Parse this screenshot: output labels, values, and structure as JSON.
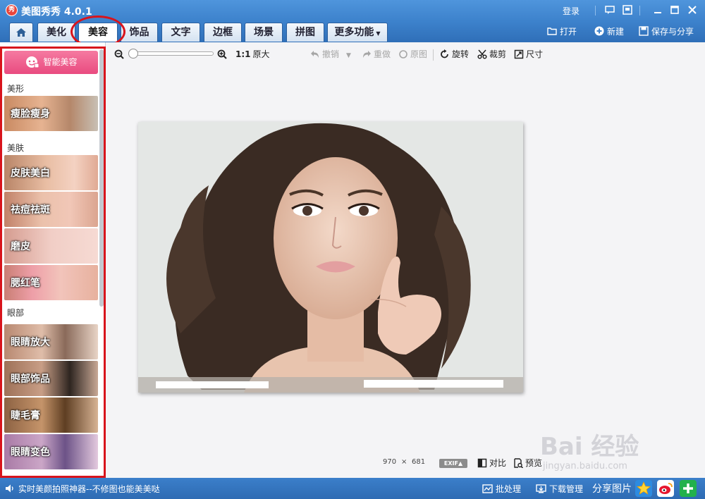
{
  "window": {
    "logo_glyph": "秀",
    "title": "美图秀秀 4.0.1",
    "login": "登录",
    "controls": [
      "message-icon",
      "skin-icon",
      "minimize-icon",
      "maximize-icon",
      "close-icon"
    ]
  },
  "tabs": [
    {
      "label": "美化",
      "active": false
    },
    {
      "label": "美容",
      "active": true
    },
    {
      "label": "饰品",
      "active": false
    },
    {
      "label": "文字",
      "active": false
    },
    {
      "label": "边框",
      "active": false
    },
    {
      "label": "场景",
      "active": false
    },
    {
      "label": "拼图",
      "active": false
    },
    {
      "label": "更多功能",
      "active": false
    }
  ],
  "actions": {
    "open": "打开",
    "new": "新建",
    "save_share": "保存与分享"
  },
  "toolbar": {
    "original_size_ratio": "1:1",
    "original_size": "原大",
    "undo": "撤销",
    "redo": "重做",
    "original": "原图",
    "rotate": "旋转",
    "crop": "裁剪",
    "size": "尺寸",
    "zoom_level": 0.0
  },
  "panel": {
    "smart_beauty": "智能美容",
    "categories": [
      {
        "label": "美形",
        "items": [
          "瘦脸瘦身"
        ]
      },
      {
        "label": "美肤",
        "items": [
          "皮肤美白",
          "祛痘祛斑",
          "磨皮",
          "腮红笔"
        ]
      },
      {
        "label": "眼部",
        "items": [
          "眼睛放大",
          "眼部饰品",
          "睫毛膏",
          "眼睛变色"
        ]
      }
    ]
  },
  "canvas": {
    "width": "970",
    "times": "×",
    "height": "681",
    "exif": "EXIF▲",
    "compare": "对比",
    "preview": "预览"
  },
  "statusbar": {
    "promo": "实时美颜拍照神器--不修图也能美美哒",
    "batch": "批处理",
    "download": "下载管理",
    "share": "分享图片"
  },
  "watermark": {
    "brand": "Bai 经验",
    "url": "jingyan.baidu.com"
  },
  "colors": {
    "accent_pink": "#e94b80",
    "annotation_red": "#d8141c",
    "chrome_blue": "#3d82cc"
  }
}
